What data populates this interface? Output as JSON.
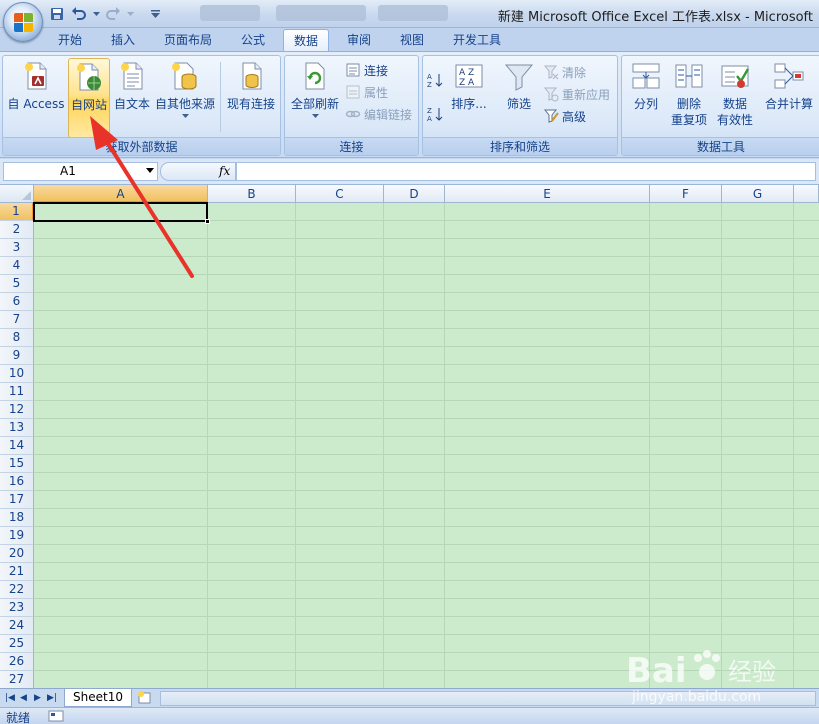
{
  "window": {
    "title": "新建 Microsoft Office Excel 工作表.xlsx - Microsoft"
  },
  "quick_access": [
    "save-icon",
    "undo-icon",
    "redo-icon",
    "customize-icon"
  ],
  "tabs": [
    {
      "label": "开始"
    },
    {
      "label": "插入"
    },
    {
      "label": "页面布局"
    },
    {
      "label": "公式"
    },
    {
      "label": "数据",
      "active": true
    },
    {
      "label": "审阅"
    },
    {
      "label": "视图"
    },
    {
      "label": "开发工具"
    }
  ],
  "ribbon": {
    "get_external": {
      "label": "获取外部数据",
      "access": "自 Access",
      "web": "自网站",
      "text": "自文本",
      "other": "自其他来源",
      "existing": "现有连接"
    },
    "connections": {
      "label": "连接",
      "refresh_all": "全部刷新",
      "connections": "连接",
      "properties": "属性",
      "edit_links": "编辑链接"
    },
    "sort_filter": {
      "label": "排序和筛选",
      "sort": "排序...",
      "filter": "筛选",
      "clear": "清除",
      "reapply": "重新应用",
      "advanced": "高级"
    },
    "data_tools": {
      "label": "数据工具",
      "text_to_columns": "分列",
      "remove_dup_1": "删除",
      "remove_dup_2": "重复项",
      "validation_1": "数据",
      "validation_2": "有效性",
      "consolidate": "合并计算"
    }
  },
  "formula_bar": {
    "name_box": "A1",
    "fx": "fx",
    "value": ""
  },
  "sheet": {
    "columns": [
      "A",
      "B",
      "C",
      "D",
      "E",
      "F",
      "G"
    ],
    "rows": [
      "1",
      "2",
      "3",
      "4",
      "5",
      "6",
      "7",
      "8",
      "9",
      "10",
      "11",
      "12",
      "13",
      "14",
      "15",
      "16",
      "17",
      "18",
      "19",
      "20",
      "21",
      "22",
      "23",
      "24",
      "25",
      "26",
      "27"
    ],
    "selected_cell": "A1"
  },
  "sheet_tabs": {
    "active": "Sheet10"
  },
  "status": {
    "ready": "就绪"
  },
  "watermark": {
    "brand": "Bai",
    "brand2": "经验",
    "url": "jingyan.baidu.com"
  }
}
